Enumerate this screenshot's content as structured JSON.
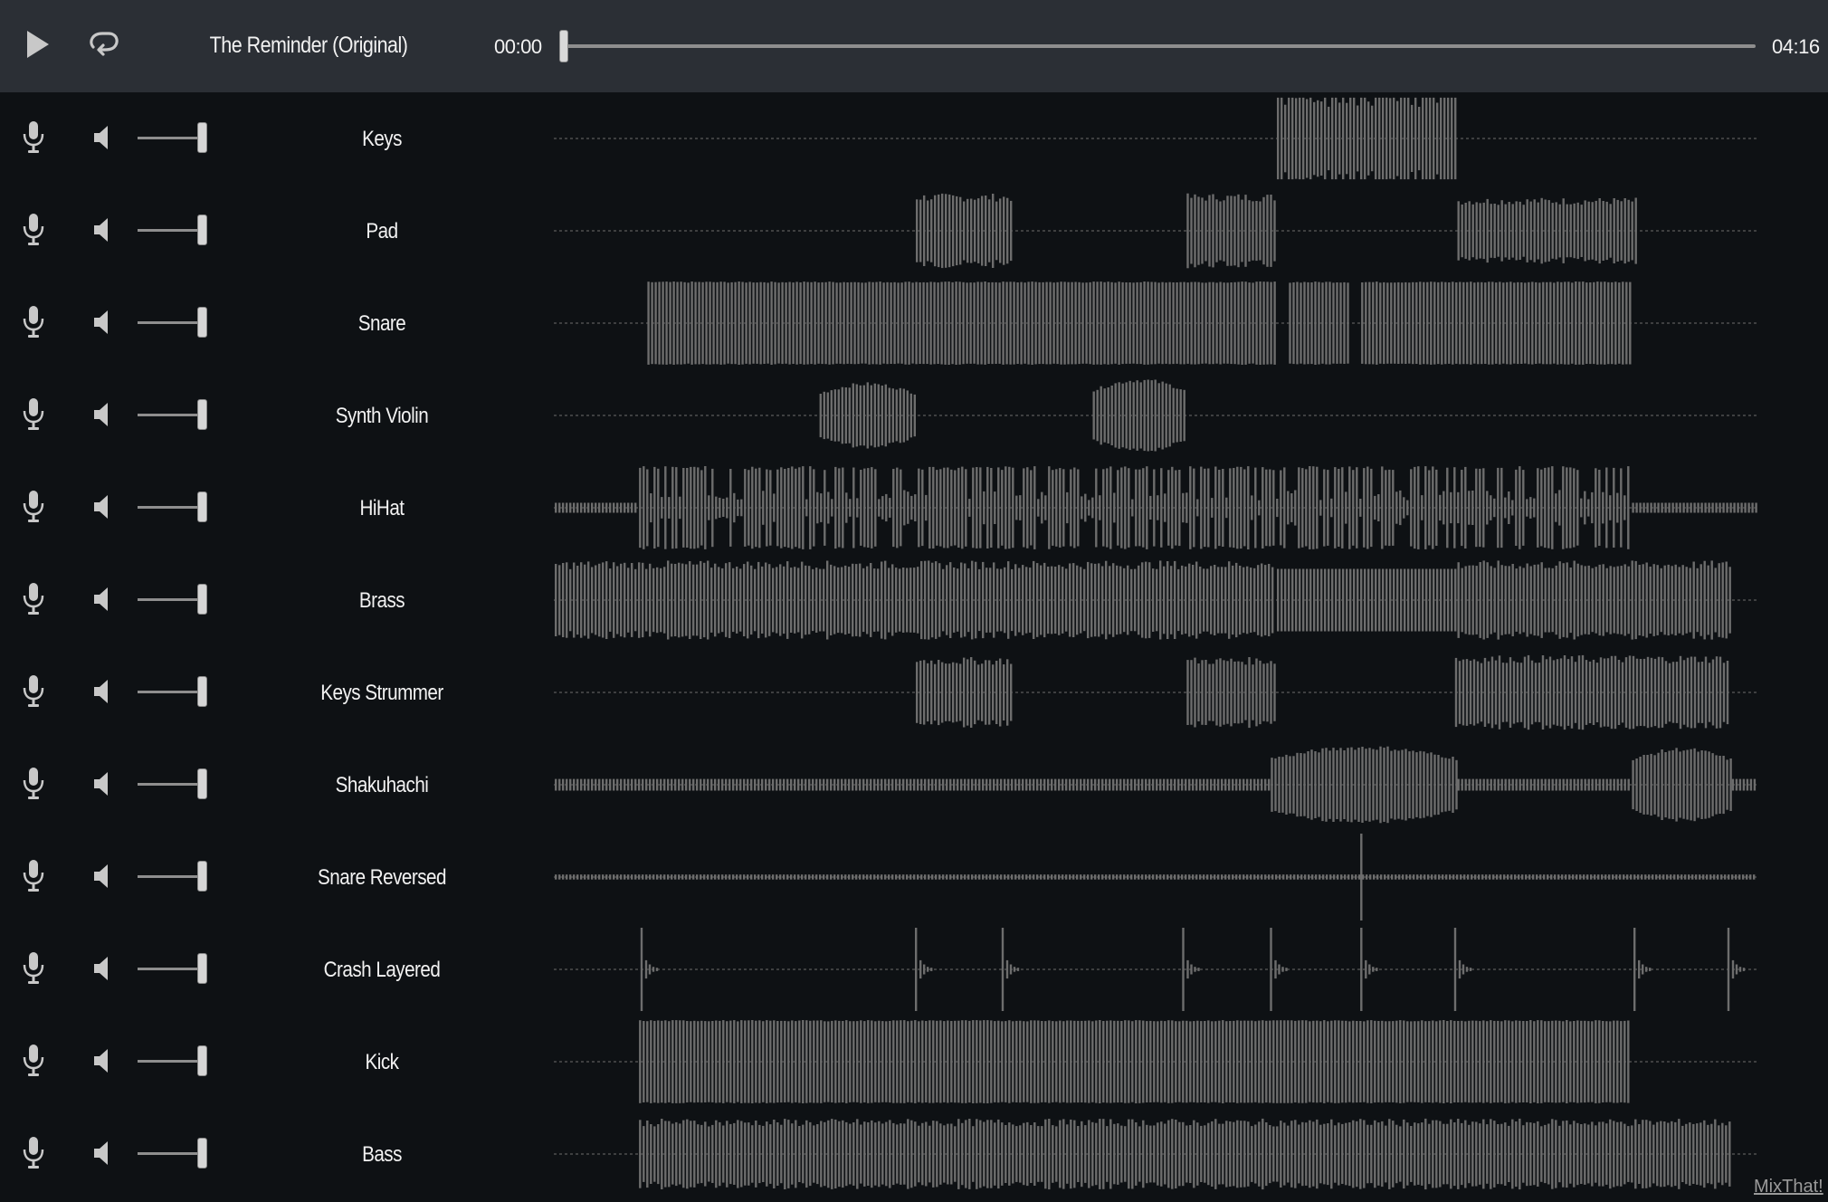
{
  "header": {
    "song_title": "The Reminder (Original)",
    "current_time": "00:00",
    "total_time": "04:16",
    "progress_fraction": 0.0,
    "play_icon": "play-icon",
    "loop_icon": "loop-icon"
  },
  "tracks": [
    {
      "name": "Keys",
      "volume": 1.0,
      "segments": [
        [
          0.6,
          0.75,
          1.0,
          "burst"
        ]
      ]
    },
    {
      "name": "Pad",
      "volume": 1.0,
      "segments": [
        [
          0.3,
          0.38,
          0.9,
          "jagged"
        ],
        [
          0.525,
          0.6,
          0.9,
          "jagged"
        ],
        [
          0.75,
          0.9,
          0.8,
          "jagged"
        ]
      ]
    },
    {
      "name": "Snare",
      "volume": 1.0,
      "segments": [
        [
          0.077,
          0.6,
          1.0,
          "dense"
        ],
        [
          0.61,
          0.66,
          1.0,
          "dense"
        ],
        [
          0.67,
          0.895,
          1.0,
          "dense"
        ]
      ]
    },
    {
      "name": "Synth Violin",
      "volume": 1.0,
      "segments": [
        [
          0.22,
          0.3,
          0.8,
          "swell"
        ],
        [
          0.447,
          0.525,
          0.9,
          "swell"
        ]
      ]
    },
    {
      "name": "HiHat",
      "volume": 1.0,
      "segments": [
        [
          0.0,
          0.07,
          0.12,
          "flat"
        ],
        [
          0.07,
          0.895,
          1.0,
          "spiky"
        ],
        [
          0.895,
          1.0,
          0.12,
          "flat"
        ]
      ]
    },
    {
      "name": "Brass",
      "volume": 1.0,
      "segments": [
        [
          0.0,
          0.6,
          0.95,
          "jagged"
        ],
        [
          0.6,
          0.75,
          0.75,
          "flat"
        ],
        [
          0.75,
          0.978,
          0.95,
          "jagged"
        ]
      ]
    },
    {
      "name": "Keys Strummer",
      "volume": 1.0,
      "segments": [
        [
          0.3,
          0.38,
          0.85,
          "jagged"
        ],
        [
          0.525,
          0.6,
          0.85,
          "jagged"
        ],
        [
          0.748,
          0.978,
          0.9,
          "jagged"
        ]
      ]
    },
    {
      "name": "Shakuhachi",
      "volume": 1.0,
      "segments": [
        [
          0.0,
          0.595,
          0.14,
          "flat"
        ],
        [
          0.595,
          0.75,
          0.95,
          "swell"
        ],
        [
          0.75,
          0.895,
          0.14,
          "flat"
        ],
        [
          0.895,
          0.978,
          0.9,
          "swell"
        ],
        [
          0.978,
          1.0,
          0.14,
          "flat"
        ]
      ]
    },
    {
      "name": "Snare Reversed",
      "volume": 1.0,
      "segments": [
        [
          0.0,
          1.0,
          0.06,
          "flat"
        ]
      ]
    },
    {
      "name": "Crash Layered",
      "volume": 1.0,
      "segments": []
    },
    {
      "name": "Kick",
      "volume": 1.0,
      "segments": [
        [
          0.07,
          0.895,
          1.0,
          "dense"
        ]
      ]
    },
    {
      "name": "Bass",
      "volume": 1.0,
      "segments": [
        [
          0.07,
          0.978,
          0.85,
          "jagged"
        ]
      ]
    }
  ],
  "crash_hits": [
    0.072,
    0.3,
    0.372,
    0.522,
    0.595,
    0.67,
    0.748,
    0.897,
    0.975
  ],
  "reverse_hit": 0.67,
  "colors": {
    "topbar": "#2b2f35",
    "background": "#0e1114",
    "waveform": "#6d6d6d",
    "text": "#f2f2f2",
    "icon": "#c8c8c8"
  },
  "footer": {
    "link_text": "MixThat!"
  },
  "track_icons": {
    "record": "microphone-icon",
    "mute": "speaker-icon",
    "volume": "volume-slider"
  }
}
